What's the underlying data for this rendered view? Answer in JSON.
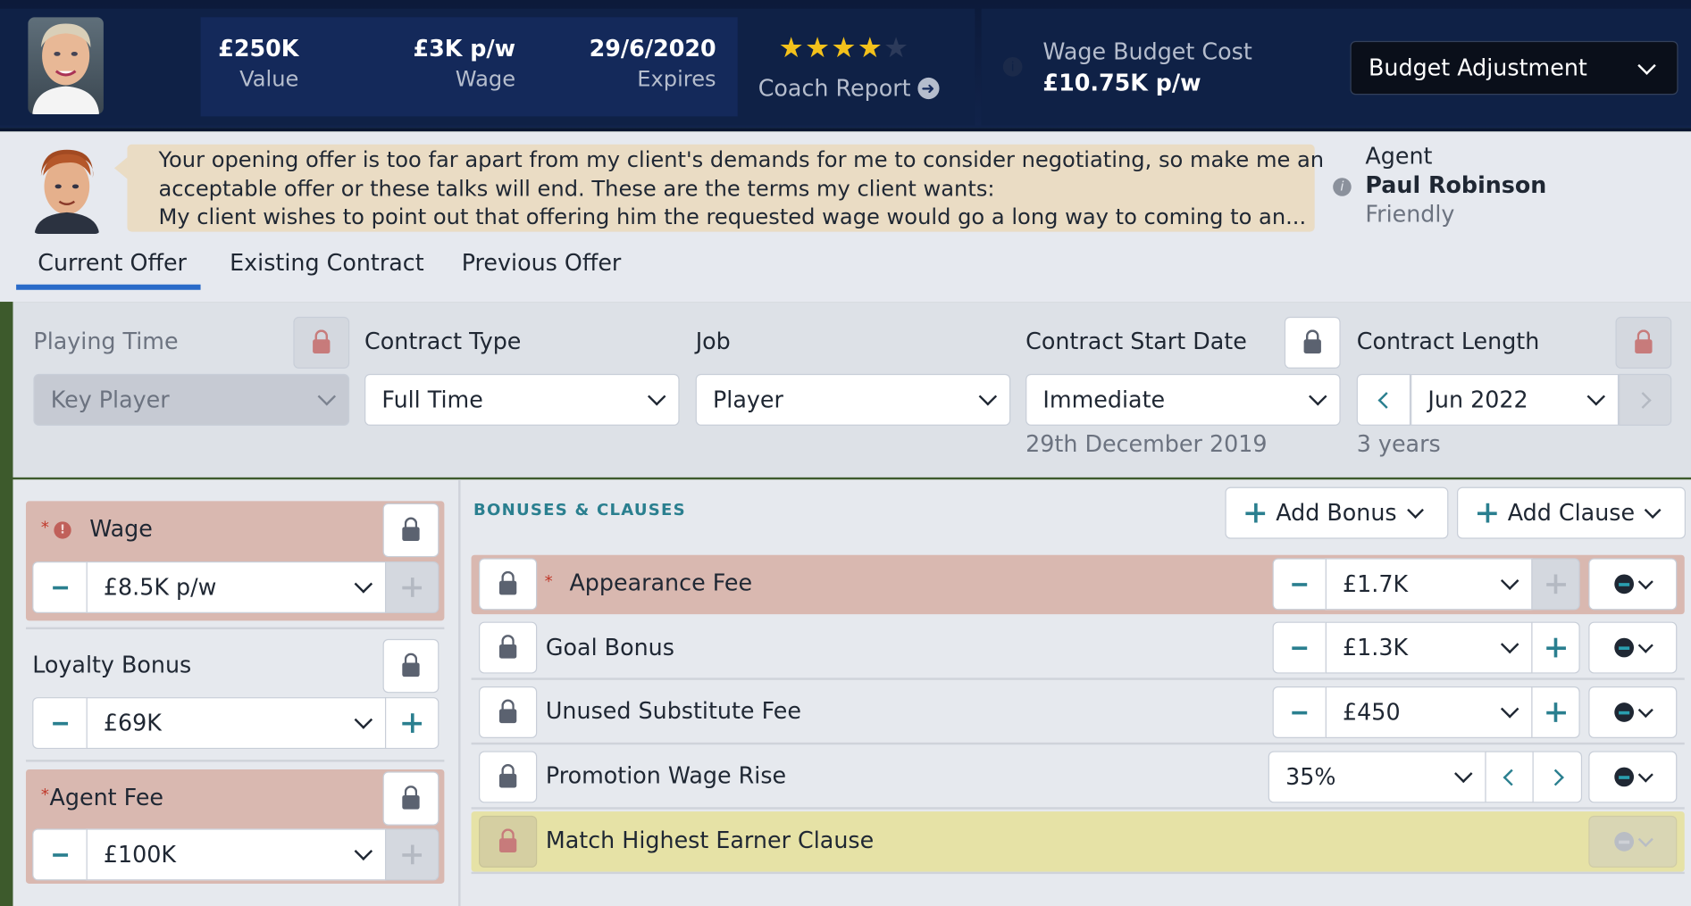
{
  "header": {
    "value_amount": "£250K",
    "value_label": "Value",
    "wage_amount": "£3K p/w",
    "wage_label": "Wage",
    "expires_date": "29/6/2020",
    "expires_label": "Expires",
    "coach_report_stars": 4,
    "coach_report_label": "Coach Report",
    "wage_budget_cost_label": "Wage Budget Cost",
    "wage_budget_cost_value": "£10.75K p/w",
    "budget_adjustment_label": "Budget Adjustment"
  },
  "agent": {
    "message_line1": "Your opening offer is too far apart from my client's demands for me to consider negotiating, so make me an",
    "message_line2": "acceptable offer or these talks will end. These are the terms my client wants:",
    "message_line3": "My client wishes to point out that offering him the requested wage would go a long way to coming to an...",
    "title": "Agent",
    "name": "Paul Robinson",
    "attitude": "Friendly"
  },
  "tabs": [
    {
      "label": "Current Offer",
      "active": true
    },
    {
      "label": "Existing Contract",
      "active": false
    },
    {
      "label": "Previous Offer",
      "active": false
    }
  ],
  "terms": {
    "playing_time_label": "Playing Time",
    "playing_time_value": "Key Player",
    "contract_type_label": "Contract Type",
    "contract_type_value": "Full Time",
    "job_label": "Job",
    "job_value": "Player",
    "start_date_label": "Contract Start Date",
    "start_date_value": "Immediate",
    "start_date_detail": "29th December 2019",
    "length_label": "Contract Length",
    "length_value": "Jun 2022",
    "length_detail": "3 years"
  },
  "left_panel": {
    "wage_label": "Wage",
    "wage_value": "£8.5K p/w",
    "loyalty_label": "Loyalty Bonus",
    "loyalty_value": "£69K",
    "agent_fee_label": "Agent Fee",
    "agent_fee_value": "£100K",
    "required_marker": "*"
  },
  "bonuses": {
    "title": "BONUSES & CLAUSES",
    "add_bonus_label": "Add Bonus",
    "add_clause_label": "Add Clause",
    "rows": [
      {
        "name": "Appearance Fee",
        "value": "£1.7K",
        "required": true
      },
      {
        "name": "Goal Bonus",
        "value": "£1.3K",
        "required": false
      },
      {
        "name": "Unused Substitute Fee",
        "value": "£450",
        "required": false
      },
      {
        "name": "Promotion Wage Rise",
        "value": "35%",
        "required": false
      },
      {
        "name": "Match Highest Earner Clause",
        "value": "",
        "required": false
      }
    ]
  },
  "colors": {
    "header_bg": "#0f2146",
    "required_row_bg": "#d9b8b0",
    "clause_row_bg": "#e6e2a6",
    "accent_teal": "#2a7f8f",
    "tab_underline": "#2a6bc9"
  }
}
